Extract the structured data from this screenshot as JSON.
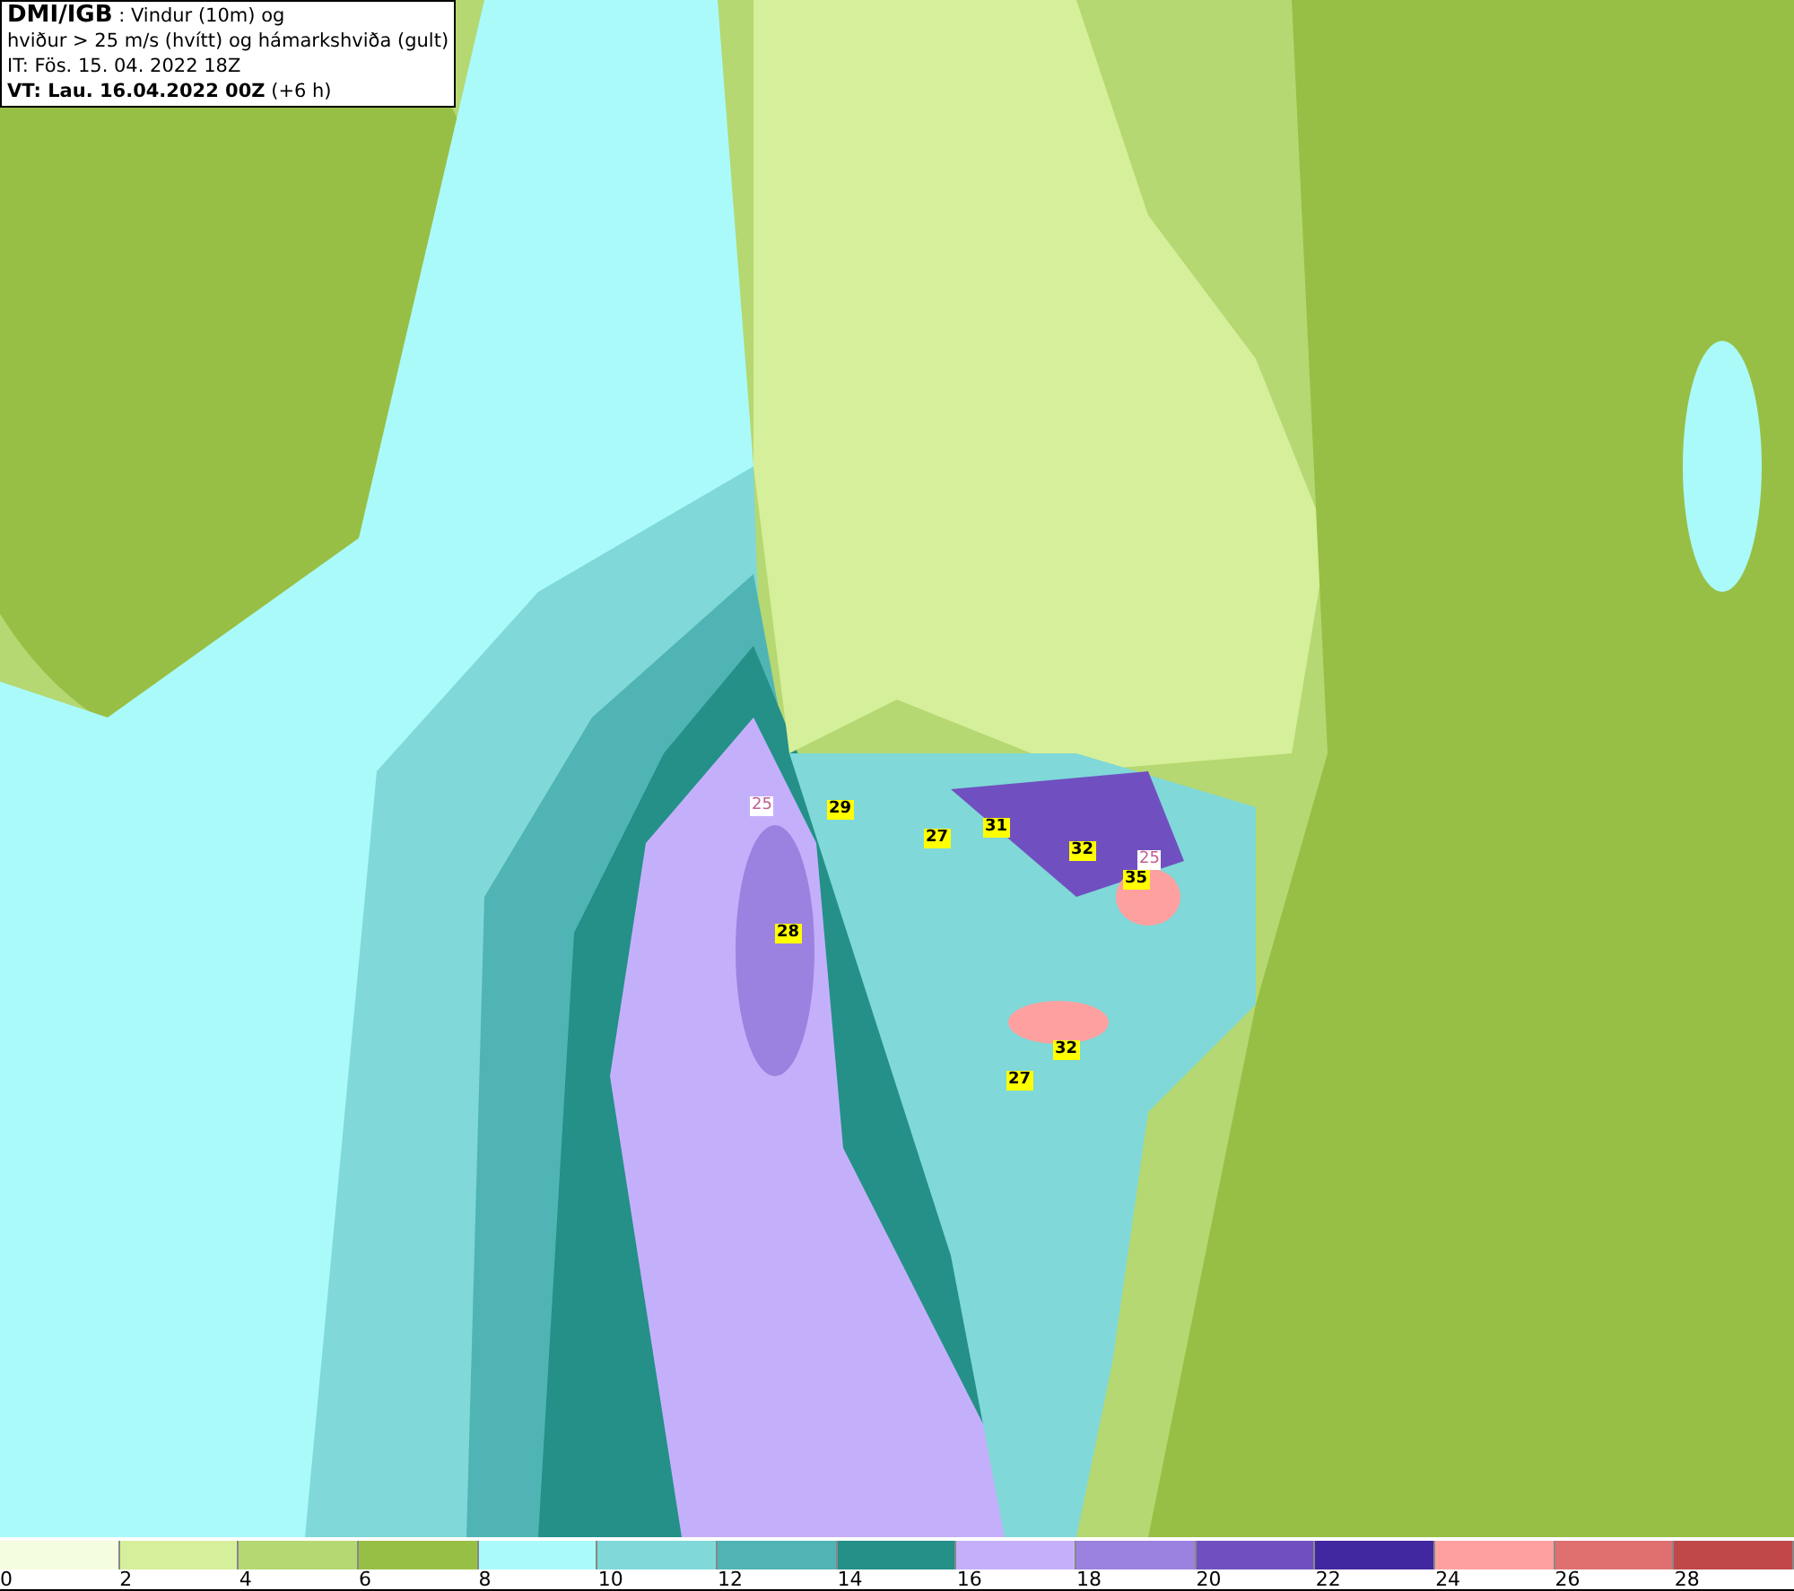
{
  "title_box": {
    "lines": [
      "**DMI/IGB** : Vindur (10m) og",
      "hviður > 25 m/s (hvítt) og hámarkshviða (gult)",
      "IT: Fös. 15. 04. 2022 18Z",
      "**VT: Lau. 16.04.2022 00Z** (+6 h)"
    ]
  },
  "map": {
    "labels": [
      {
        "kind": "threshold",
        "text": "25"
      },
      {
        "kind": "gust",
        "text": "29"
      },
      {
        "kind": "gust",
        "text": "27"
      },
      {
        "kind": "gust",
        "text": "31"
      },
      {
        "kind": "gust",
        "text": "32"
      },
      {
        "kind": "threshold",
        "text": "25"
      },
      {
        "kind": "gust",
        "text": "35"
      },
      {
        "kind": "gust",
        "text": "28"
      },
      {
        "kind": "gust",
        "text": "32"
      },
      {
        "kind": "gust",
        "text": "27"
      }
    ]
  },
  "legend": [
    {
      "color": "#f5fde0",
      "label": "0"
    },
    {
      "color": "#d6ef9a",
      "label": "2"
    },
    {
      "color": "#b5d872",
      "label": "4"
    },
    {
      "color": "#98bf45",
      "label": "6"
    },
    {
      "color": "#aafafa",
      "label": "8"
    },
    {
      "color": "#80d8d8",
      "label": "10"
    },
    {
      "color": "#50b4b4",
      "label": "12"
    },
    {
      "color": "#249088",
      "label": "14"
    },
    {
      "color": "#c4b0fa",
      "label": "16"
    },
    {
      "color": "#9b82e0",
      "label": "18"
    },
    {
      "color": "#7050c0",
      "label": "20"
    },
    {
      "color": "#4228a0",
      "label": "22"
    },
    {
      "color": "#ffa0a0",
      "label": "24"
    },
    {
      "color": "#e07070",
      "label": "26"
    },
    {
      "color": "#c04848",
      "label": "28"
    }
  ]
}
